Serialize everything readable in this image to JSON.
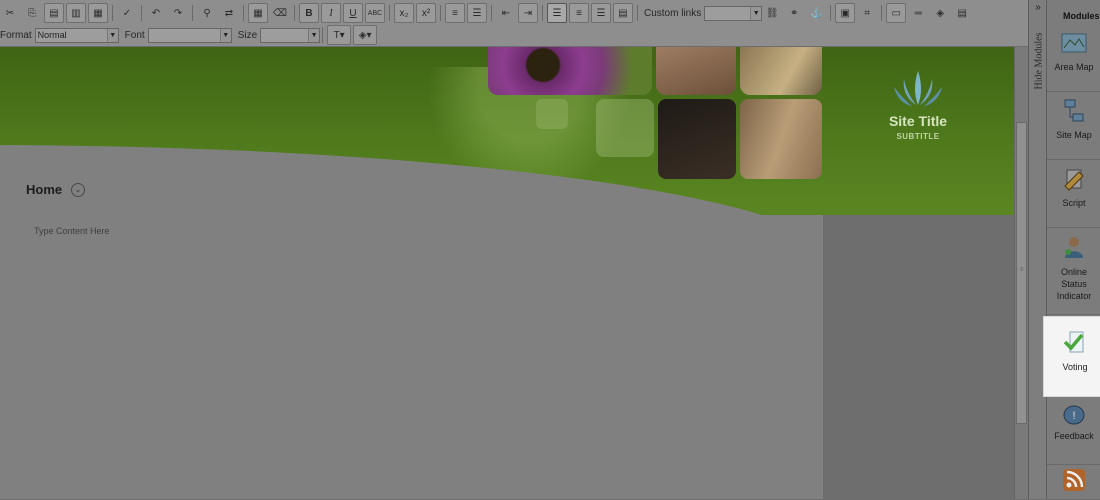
{
  "toolbar": {
    "row1": {
      "custom_links_label": "Custom links",
      "custom_links_value": ""
    },
    "row2": {
      "format_label": "Format",
      "format_value": "Normal",
      "font_label": "Font",
      "font_value": "",
      "size_label": "Size",
      "size_value": ""
    }
  },
  "page": {
    "site_title": "Site Title",
    "site_subtitle": "SUBTITLE",
    "home_title": "Home",
    "content_placeholder": "Type Content Here"
  },
  "side_panel": {
    "hide_modules_label": "Hide Modules",
    "modules_title": "Modules",
    "modules": [
      {
        "label": "Area Map",
        "icon": "area-map-icon"
      },
      {
        "label": "Site Map",
        "icon": "site-map-icon"
      },
      {
        "label": "Script",
        "icon": "script-icon"
      },
      {
        "label": "Online Status Indicator",
        "icon": "online-status-icon"
      },
      {
        "label": "Voting",
        "icon": "voting-icon"
      },
      {
        "label": "Feedback",
        "icon": "feedback-icon"
      },
      {
        "label": "",
        "icon": "rss-icon"
      }
    ]
  },
  "colors": {
    "banner_green": "#4e7a1c",
    "highlight_bg": "#f4f4f4",
    "overlay_gray": "#7c7c7c"
  }
}
